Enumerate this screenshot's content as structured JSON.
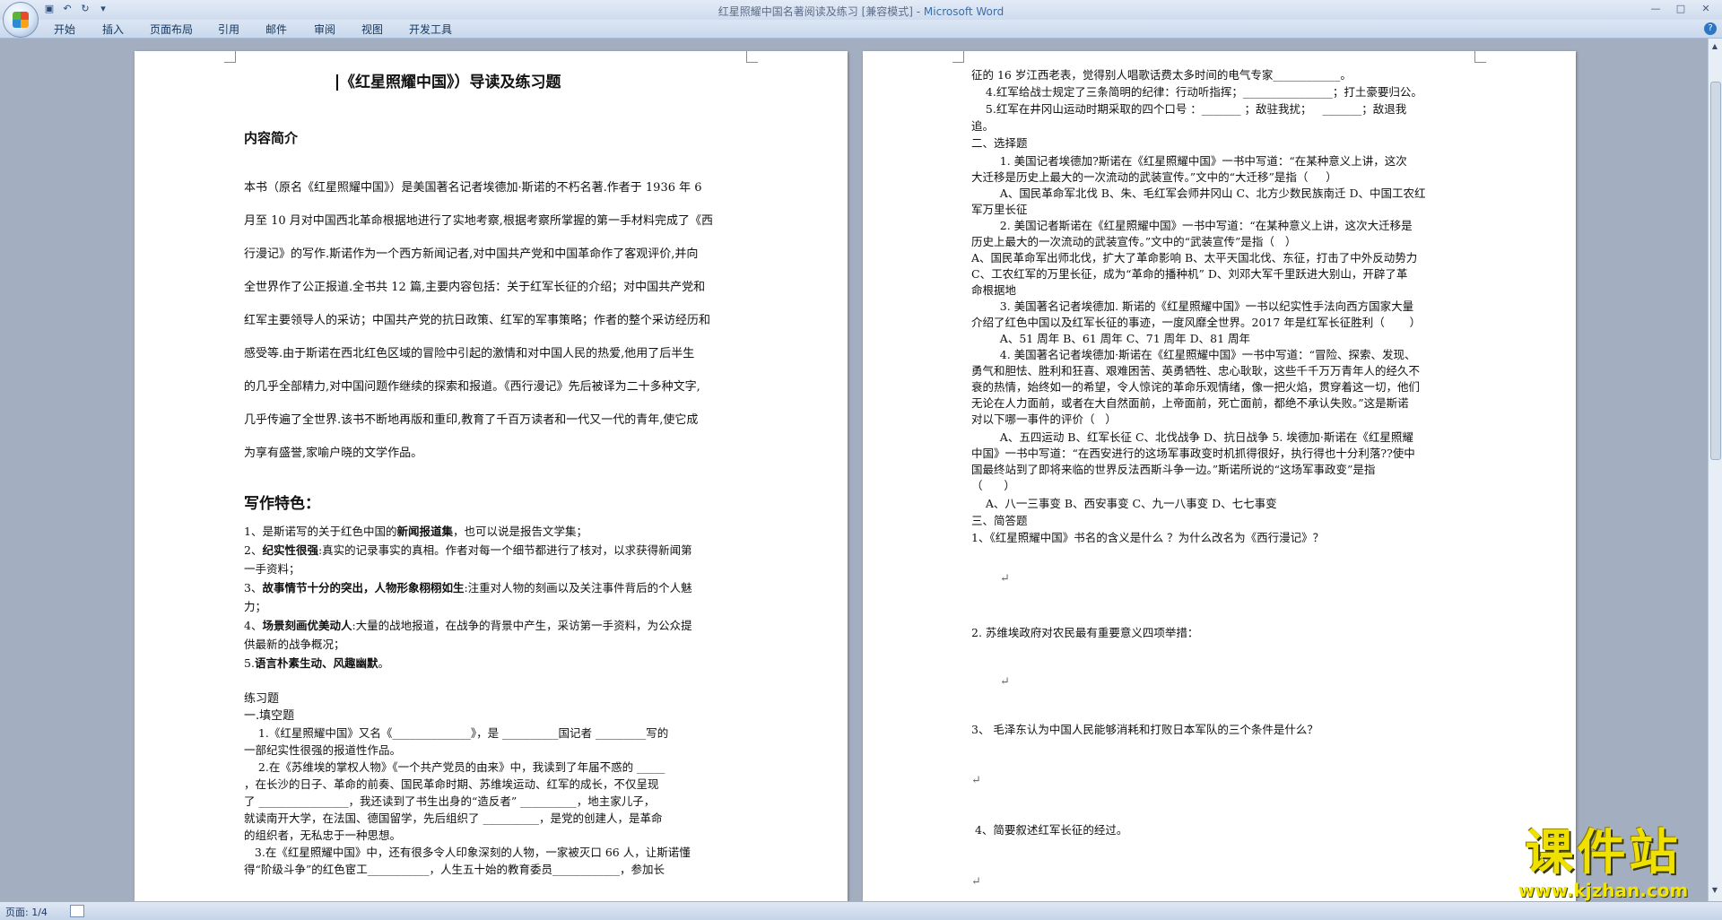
{
  "window": {
    "title": "红星照耀中国名著阅读及练习 [兼容模式] - ",
    "app_name": "Microsoft Word"
  },
  "ribbon": {
    "tabs": [
      "开始",
      "插入",
      "页面布局",
      "引用",
      "邮件",
      "审阅",
      "视图",
      "开发工具"
    ]
  },
  "statusbar": {
    "page": "页面: 1/4"
  },
  "watermark": {
    "text": "课件站",
    "url": "www.kjzhan.com"
  },
  "page1": {
    "title": "《红星照耀中国》）导读及练习题",
    "intro_heading": "内容简介",
    "intro": [
      "本书（原名《红星照耀中国》）是美国著名记者埃德加·斯诺的不朽名著.作者于 1936 年 6",
      "月至 10 月对中国西北革命根据地进行了实地考察,根据考察所掌握的第一手材料完成了《西",
      "行漫记》的写作.斯诺作为一个西方新闻记者,对中国共产党和中国革命作了客观评价,并向",
      "全世界作了公正报道.全书共 12 篇,主要内容包括：关于红军长征的介绍；对中国共产党和",
      "红军主要领导人的采访；中国共产党的抗日政策、红军的军事策略；作者的整个采访经历和",
      "感受等.由于斯诺在西北红色区域的冒险中引起的激情和对中国人民的热爱,他用了后半生",
      "的几乎全部精力,对中国问题作继续的探索和报道。《西行漫记》先后被译为二十多种文字,",
      "几乎传遍了全世界.该书不断地再版和重印,教育了千百万读者和一代又一代的青年,使它成",
      "为享有盛誉,家喻户晓的文学作品。"
    ],
    "features_heading": "写作特色：",
    "features": [
      [
        "1、是斯诺写的关于红色中国的",
        "新闻报道集",
        "，也可以说是报告文学集；"
      ],
      [
        "2、",
        "纪实性很强",
        ":真实的记录事实的真相。作者对每一个细节都进行了核对，以求获得新闻第"
      ],
      [
        "一手资料；",
        "",
        ""
      ],
      [
        "3、",
        "故事情节十分的突出，人物形象栩栩如生",
        ":注重对人物的刻画以及关注事件背后的个人魅"
      ],
      [
        "力；",
        "",
        ""
      ],
      [
        "4、",
        "场景刻画优美动人",
        ":大量的战地报道，在战争的背景中产生，采访第一手资料，为公众提"
      ],
      [
        "供最新的战争概况；",
        "",
        ""
      ],
      [
        "5.",
        "语言朴素生动、风趣幽默",
        "。"
      ]
    ],
    "exercises_heading": "练习题",
    "fill_heading": "一.填空题",
    "fill": [
      "    1.《红星照耀中国》又名《______________》，是 __________国记者 _________写的",
      "一部纪实性很强的报道性作品。",
      "    2.在《苏维埃的掌权人物》《一个共产党员的由来》中，我读到了年届不惑的 _____",
      "，在长沙的日子、革命的前奏、国民革命时期、苏维埃运动、红军的成长，不仅呈现",
      "了 ________________，我还读到了书生出身的“造反者” __________，地主家儿子，",
      "就读南开大学，在法国、德国留学，先后组织了 __________，是党的创建人，是革命",
      "的组织者，无私忠于一种思想。",
      "   3.在《红星照耀中国》中，还有很多令人印象深刻的人物，一家被灭口 66 人，让斯诺懂",
      "得“阶级斗争”的红色宦工___________，人生五十始的教育委员____________，参加长"
    ]
  },
  "page2": {
    "lines_top": [
      "征的 16 岁江西老表，觉得别人唱歌话费太多时间的电气专家____________。",
      "    4.红军给战士规定了三条简明的纪律：行动听指挥；________________；打土豪要归公。",
      "    5.红军在井冈山运动时期采取的四个口号 ：_______ ；敌驻我扰；   _______；敌退我",
      "追。"
    ],
    "choice_heading": "二、选择题",
    "choice": [
      "        1. 美国记者埃德加?斯诺在《红星照耀中国》一书中写道：“在某种意义上讲，这次",
      "大迁移是历史上最大的一次流动的武装宣传。”文中的“大迁移”是指（     ）",
      "        A、国民革命军北伐 B、朱、毛红军会师井冈山 C、北方少数民族南迁 D、中国工农红",
      "军万里长征",
      "        2. 美国记者斯诺在《红星照耀中国》一书中写道：“在某种意义上讲，这次大迁移是",
      "历史上最大的一次流动的武装宣传。”文中的“武装宣传”是指（   ）",
      "A、国民革命军出师北伐，扩大了革命影响 B、太平天国北伐、东征，打击了中外反动势力",
      "C、工农红军的万里长征，成为“革命的播种机” D、刘邓大军千里跃进大别山，开辟了革",
      "命根据地",
      "        3. 美国著名记者埃德加. 斯诺的《红星照耀中国》一书以纪实性手法向西方国家大量",
      "介绍了红色中国以及红军长征的事迹，一度风靡全世界。2017 年是红军长征胜利（       ）",
      "        A、51 周年 B、61 周年 C、71 周年 D、81 周年",
      "        4. 美国著名记者埃德加·斯诺在《红星照耀中国》一书中写道：“冒险、探索、发现、",
      "勇气和胆怯、胜利和狂喜、艰难困苦、英勇牺牲、忠心耿耿，这些千千万万青年人的经久不",
      "衰的热情，始终如一的希望，令人惊诧的革命乐观情绪，像一把火焰，贯穿着这一切，他们",
      "无论在人力面前，或者在大自然面前，上帝面前，死亡面前，都绝不承认失败。”这是斯诺",
      "对以下哪一事件的评价（   ）",
      "        A、五四运动 B、红军长征 C、北伐战争 D、抗日战争 5. 埃德加·斯诺在《红星照耀",
      "中国》一书中写道：“在西安进行的这场军事政变时机抓得很好，执行得也十分利落??使中",
      "国最终站到了即将来临的世界反法西斯斗争一边。”斯诺所说的“这场军事政变”是指",
      "（      ）",
      "    A、八一三事变 B、西安事变 C、九一八事变 D、七七事变"
    ],
    "short_heading": "三、简答题",
    "short": [
      "1、《红星照耀中国》书名的含义是什么 ？为什么改名为《西行漫记》？",
      "2. 苏维埃政府对农民最有重要意义四项举措：",
      "3、 毛泽东认为中国人民能够消耗和打败日本军队的三个条件是什么？",
      " 4、简要叙述红军长征的经过。"
    ]
  }
}
